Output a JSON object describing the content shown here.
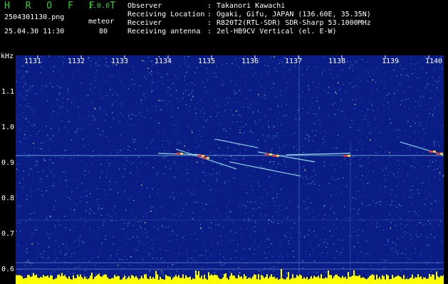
{
  "app": {
    "name": "H R O F F T",
    "version": "1.0.0"
  },
  "file": {
    "name": "2504301130.png",
    "mode": "meteor",
    "datetime": "25.04.30 11:30",
    "count": "80"
  },
  "info": [
    {
      "label": "Observer",
      "value": "Takanori Kawachi"
    },
    {
      "label": "Receiving Location",
      "value": "Ogaki, Gifu, JAPAN (136.60E, 35.35N)"
    },
    {
      "label": "Receiver",
      "value": "R820T2(RTL-SDR) SDR-Sharp 53.1000MHz"
    },
    {
      "label": "Receiving antenna",
      "value": "2el-HB9CV Vertical (el. E-W)"
    }
  ],
  "colon": ":",
  "axis": {
    "unit": "kHz",
    "y_ticks": [
      "1.1",
      "1.0",
      "0.9",
      "0.8",
      "0.7",
      "0.6"
    ],
    "x_ticks": [
      "1131",
      "1132",
      "1133",
      "1134",
      "1135",
      "1136",
      "1137",
      "1138",
      "1139",
      "1140"
    ]
  },
  "colors": {
    "background": "#000000",
    "title": "#2bd62b",
    "spectrum_bg": "#0a1d86",
    "noise": "#4fc7d8",
    "signal": "#e03a3a",
    "power": "#ffff00"
  }
}
